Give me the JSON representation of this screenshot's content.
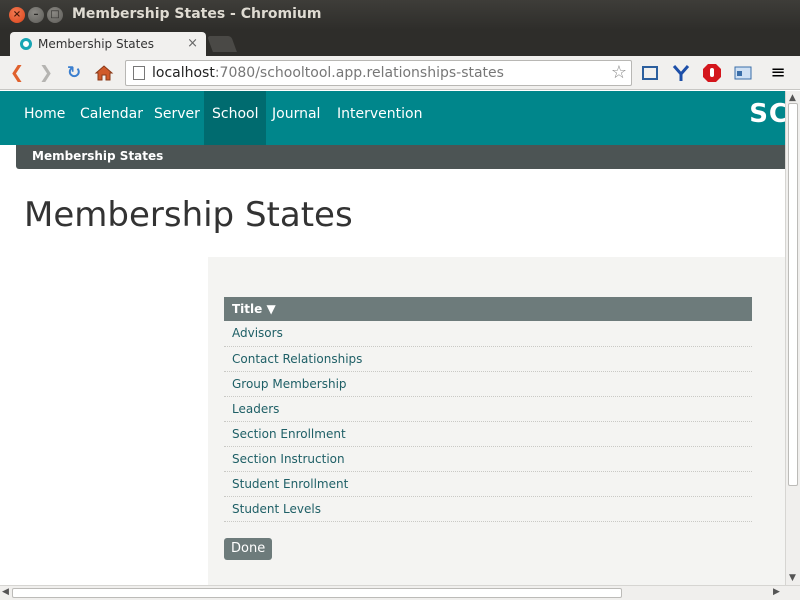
{
  "window": {
    "title": "Membership States - Chromium"
  },
  "tab": {
    "title": "Membership States"
  },
  "omnibox": {
    "host": "localhost",
    "path": ":7080/schooltool.app.relationships-states"
  },
  "nav": {
    "items": [
      {
        "label": "Home"
      },
      {
        "label": "Calendar"
      },
      {
        "label": "Server"
      },
      {
        "label": "School",
        "active": true
      },
      {
        "label": "Journal"
      },
      {
        "label": "Intervention"
      }
    ],
    "logo": "SC"
  },
  "breadcrumb": {
    "label": "Membership States"
  },
  "page": {
    "title": "Membership States"
  },
  "table": {
    "header": "Title ▼",
    "rows": [
      "Advisors",
      "Contact Relationships",
      "Group Membership",
      "Leaders",
      "Section Enrollment",
      "Section Instruction",
      "Student Enrollment",
      "Student Levels"
    ]
  },
  "actions": {
    "done_label": "Done"
  },
  "colors": {
    "nav_bg": "#00868b",
    "nav_active": "#006b6f",
    "breadcrumb_bg": "#4c5454",
    "table_header": "#6d7b7b",
    "link": "#1e5f66"
  }
}
